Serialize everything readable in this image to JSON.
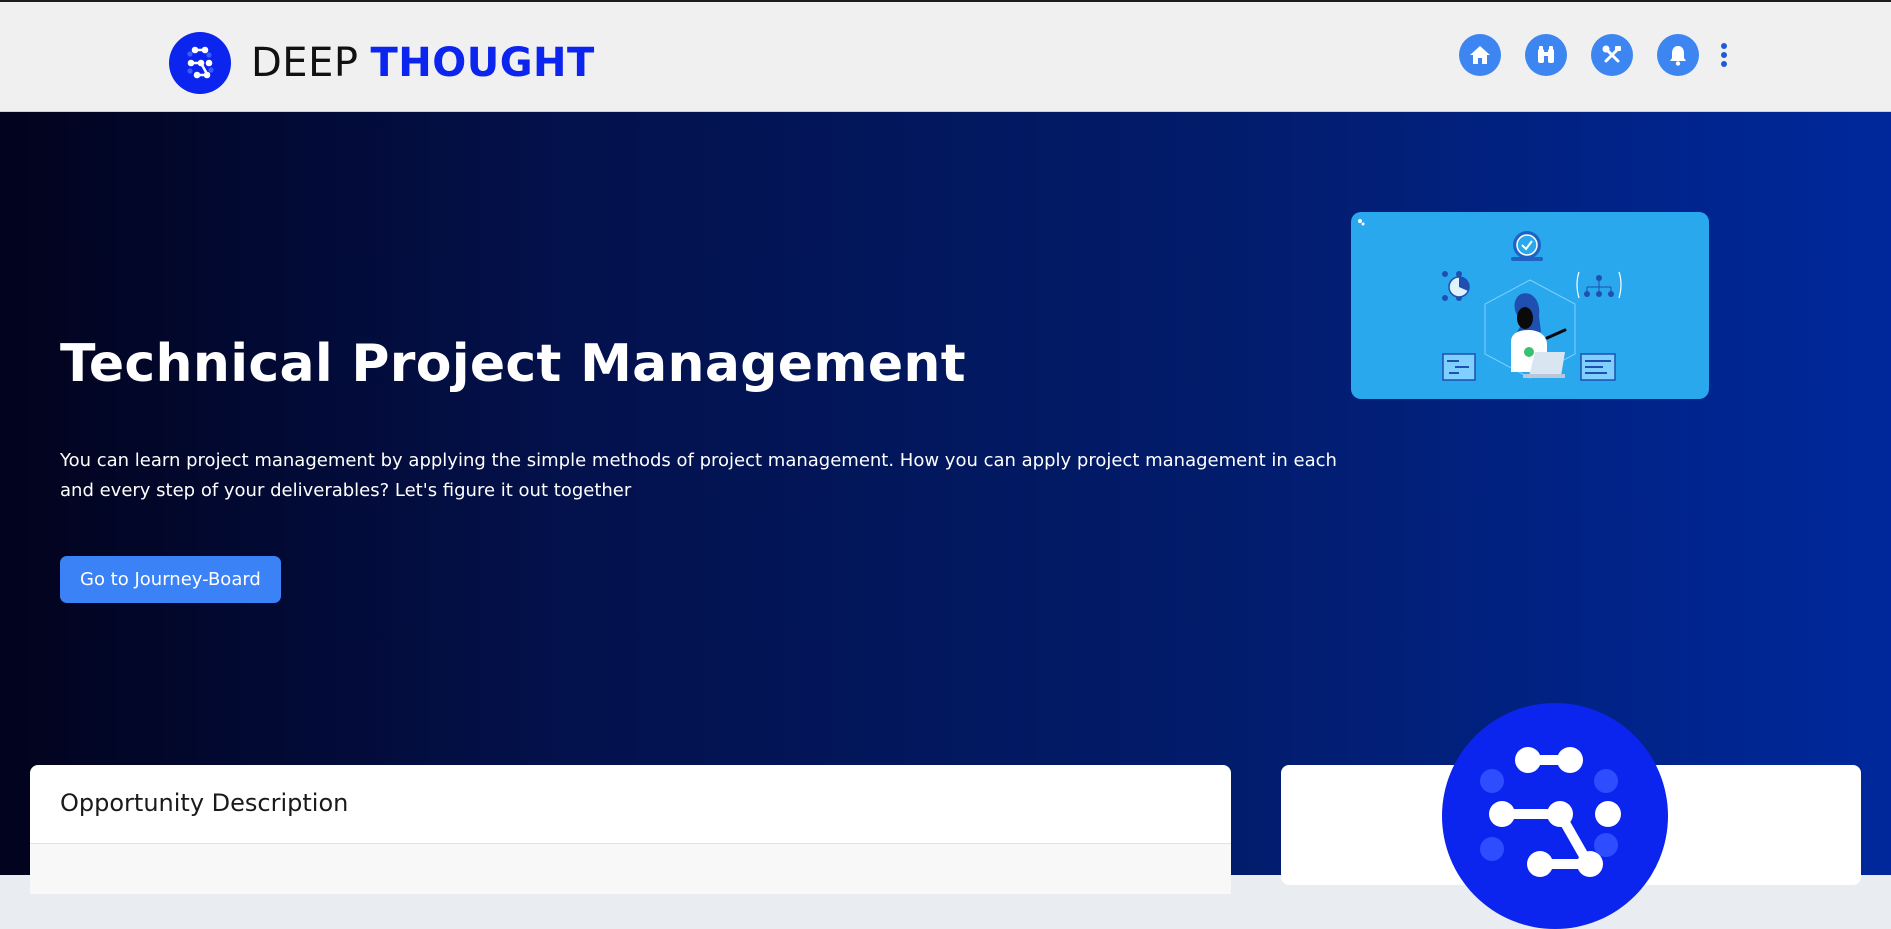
{
  "header": {
    "brand_part1": "DEEP",
    "brand_part2": "THOUGHT",
    "logo_icon": "deep-thought-logo-icon",
    "nav_icons": [
      "home-icon",
      "binoculars-icon",
      "tools-icon",
      "bell-icon",
      "more-vertical-icon"
    ],
    "accent_color": "#0b24ee",
    "nav_button_color": "#3d85f0"
  },
  "hero": {
    "title": "Technical Project Management",
    "description": "You can learn project management by applying the simple methods of project management. How you can apply project management in each and every step of your deliverables? Let's figure it out together",
    "cta_label": "Go to Journey-Board",
    "cta_color": "#3b82f6",
    "illustration": "project-management-illustration"
  },
  "cards": {
    "left_title": "Opportunity Description"
  }
}
